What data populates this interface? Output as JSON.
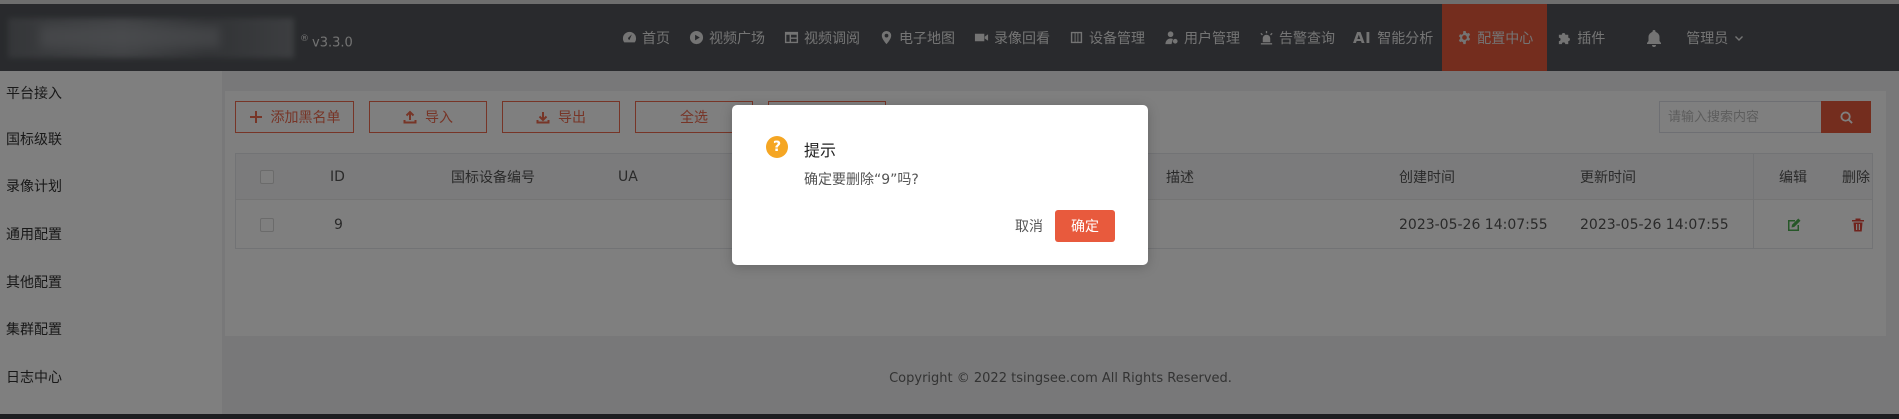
{
  "header": {
    "version": "v3.3.0",
    "registered_mark": "®",
    "nav": [
      {
        "label": "首页",
        "icon": "dashboard-icon"
      },
      {
        "label": "视频广场",
        "icon": "play-circle-icon"
      },
      {
        "label": "视频调阅",
        "icon": "grid-icon"
      },
      {
        "label": "电子地图",
        "icon": "map-pin-icon"
      },
      {
        "label": "录像回看",
        "icon": "video-camera-icon"
      },
      {
        "label": "设备管理",
        "icon": "device-icon"
      },
      {
        "label": "用户管理",
        "icon": "user-gear-icon"
      },
      {
        "label": "告警查询",
        "icon": "alarm-light-icon"
      },
      {
        "label": "智能分析",
        "icon": "ai-icon",
        "prefix": "AI"
      },
      {
        "label": "配置中心",
        "icon": "gear-icon",
        "active": true
      },
      {
        "label": "插件",
        "icon": "puzzle-icon"
      }
    ],
    "user": "管理员"
  },
  "sidebar": {
    "items": [
      "平台接入",
      "国标级联",
      "录像计划",
      "通用配置",
      "其他配置",
      "集群配置",
      "日志中心"
    ]
  },
  "toolbar": {
    "add_blacklist": "添加黑名单",
    "import": "导入",
    "export": "导出",
    "select_all": "全选"
  },
  "search": {
    "placeholder": "请输入搜索内容"
  },
  "table": {
    "headers": {
      "id": "ID",
      "gb_device_id": "国标设备编号",
      "ua": "UA",
      "description": "描述",
      "created_at": "创建时间",
      "updated_at": "更新时间",
      "edit": "编辑",
      "delete": "删除"
    },
    "rows": [
      {
        "id": "9",
        "gb_device_id": "",
        "ua": "",
        "description": "",
        "created_at": "2023-05-26 14:07:55",
        "updated_at": "2023-05-26 14:07:55"
      }
    ]
  },
  "footer": {
    "copyright": "Copyright © 2022 tsingsee.com All Rights Reserved."
  },
  "dialog": {
    "icon": "?",
    "title": "提示",
    "message": "确定要删除“9”吗?",
    "cancel": "取消",
    "confirm": "确定"
  },
  "colors": {
    "topbar": "#52555a",
    "accent": "#e85a3d",
    "edit": "#4caf50",
    "delete": "#e0473a",
    "warning": "#f5a623"
  }
}
